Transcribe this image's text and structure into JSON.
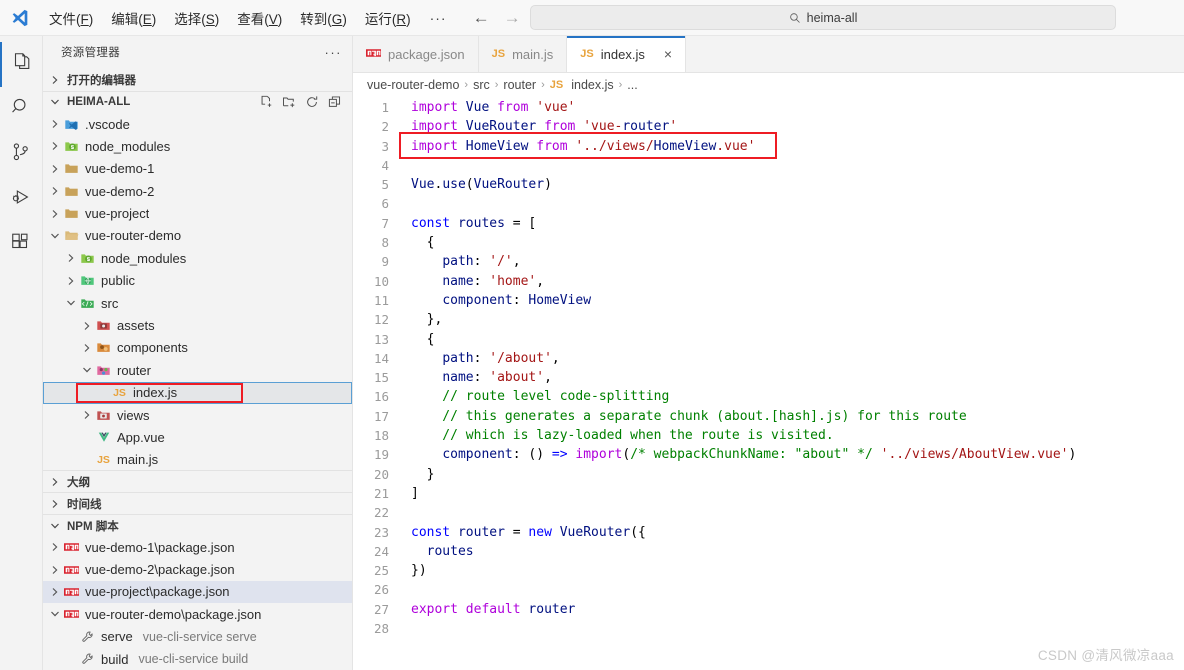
{
  "titlebar": {
    "logo": "vscode-logo",
    "menus": [
      {
        "text": "文件",
        "accel": "F"
      },
      {
        "text": "编辑",
        "accel": "E"
      },
      {
        "text": "选择",
        "accel": "S"
      },
      {
        "text": "查看",
        "accel": "V"
      },
      {
        "text": "转到",
        "accel": "G"
      },
      {
        "text": "运行",
        "accel": "R"
      }
    ],
    "more_label": "···",
    "back_label": "←",
    "forward_label": "→",
    "search": {
      "value": "heima-all",
      "placeholder": "heima-all",
      "icon": "search-icon"
    }
  },
  "activitybar": {
    "items": [
      {
        "name": "explorer",
        "icon": "files-icon",
        "active": true
      },
      {
        "name": "search",
        "icon": "search-icon",
        "active": false
      },
      {
        "name": "source-control",
        "icon": "source-control-icon",
        "active": false
      },
      {
        "name": "run-debug",
        "icon": "run-debug-icon",
        "active": false
      },
      {
        "name": "extensions",
        "icon": "extensions-icon",
        "active": false
      }
    ]
  },
  "sidebar": {
    "title": "资源管理器",
    "more_label": "···",
    "open_editors": {
      "label": "打开的编辑器",
      "expanded": false
    },
    "workspace": {
      "label": "HEIMA-ALL",
      "expanded": true,
      "actions": [
        "new-file-icon",
        "new-folder-icon",
        "refresh-icon",
        "collapse-all-icon"
      ]
    },
    "tree": [
      {
        "label": ".vscode",
        "depth": 1,
        "type": "folder",
        "icon": "vscode-folder-icon",
        "twisty": "collapsed"
      },
      {
        "label": "node_modules",
        "depth": 1,
        "type": "folder",
        "icon": "node-folder-icon",
        "twisty": "collapsed"
      },
      {
        "label": "vue-demo-1",
        "depth": 1,
        "type": "folder",
        "icon": "folder-icon",
        "twisty": "collapsed"
      },
      {
        "label": "vue-demo-2",
        "depth": 1,
        "type": "folder",
        "icon": "folder-icon",
        "twisty": "collapsed"
      },
      {
        "label": "vue-project",
        "depth": 1,
        "type": "folder",
        "icon": "folder-icon",
        "twisty": "collapsed"
      },
      {
        "label": "vue-router-demo",
        "depth": 1,
        "type": "folder",
        "icon": "folder-open-icon",
        "twisty": "expanded"
      },
      {
        "label": "node_modules",
        "depth": 2,
        "type": "folder",
        "icon": "node-folder-icon",
        "twisty": "collapsed"
      },
      {
        "label": "public",
        "depth": 2,
        "type": "folder",
        "icon": "public-folder-icon",
        "twisty": "collapsed"
      },
      {
        "label": "src",
        "depth": 2,
        "type": "folder",
        "icon": "src-folder-icon",
        "twisty": "expanded"
      },
      {
        "label": "assets",
        "depth": 3,
        "type": "folder",
        "icon": "assets-folder-icon",
        "twisty": "collapsed"
      },
      {
        "label": "components",
        "depth": 3,
        "type": "folder",
        "icon": "components-folder-icon",
        "twisty": "collapsed"
      },
      {
        "label": "router",
        "depth": 3,
        "type": "folder",
        "icon": "router-folder-icon",
        "twisty": "expanded"
      },
      {
        "label": "index.js",
        "depth": 4,
        "type": "file",
        "icon": "js-icon",
        "twisty": "none",
        "selected": true,
        "highlighted": true
      },
      {
        "label": "views",
        "depth": 3,
        "type": "folder",
        "icon": "views-folder-icon",
        "twisty": "collapsed"
      },
      {
        "label": "App.vue",
        "depth": 3,
        "type": "file",
        "icon": "vue-icon",
        "twisty": "none"
      },
      {
        "label": "main.js",
        "depth": 3,
        "type": "file",
        "icon": "js-icon",
        "twisty": "none"
      }
    ],
    "outline": {
      "label": "大纲",
      "expanded": false
    },
    "timeline": {
      "label": "时间线",
      "expanded": false
    },
    "npm_scripts": {
      "label": "NPM 脚本",
      "expanded": true,
      "items": [
        {
          "label": "vue-demo-1\\package.json",
          "depth": 1,
          "icon": "npm-icon",
          "twisty": "collapsed"
        },
        {
          "label": "vue-demo-2\\package.json",
          "depth": 1,
          "icon": "npm-icon",
          "twisty": "collapsed"
        },
        {
          "label": "vue-project\\package.json",
          "depth": 1,
          "icon": "npm-icon",
          "twisty": "collapsed",
          "highlighted": true
        },
        {
          "label": "vue-router-demo\\package.json",
          "depth": 1,
          "icon": "npm-icon",
          "twisty": "expanded"
        },
        {
          "label": "serve",
          "detail": "vue-cli-service serve",
          "depth": 2,
          "icon": "wrench-icon",
          "twisty": "none"
        },
        {
          "label": "build",
          "detail": "vue-cli-service build",
          "depth": 2,
          "icon": "wrench-icon",
          "twisty": "none"
        }
      ]
    }
  },
  "editor": {
    "tabs": [
      {
        "label": "package.json",
        "icon": "npm-icon",
        "active": false,
        "closable": false
      },
      {
        "label": "main.js",
        "icon": "js-icon",
        "active": false,
        "closable": false
      },
      {
        "label": "index.js",
        "icon": "js-icon",
        "active": true,
        "closable": true,
        "close_label": "×"
      }
    ],
    "breadcrumb": [
      "vue-router-demo",
      "src",
      "router",
      "index.js",
      "..."
    ],
    "breadcrumb_file_icon": "js-icon",
    "line_numbers": [
      1,
      2,
      3,
      4,
      5,
      6,
      7,
      8,
      9,
      10,
      11,
      12,
      13,
      14,
      15,
      16,
      17,
      18,
      19,
      20,
      21,
      22,
      23,
      24,
      25,
      26,
      27,
      28
    ],
    "lines": [
      "import Vue from 'vue'",
      "import VueRouter from 'vue-router'",
      "import HomeView from '../views/HomeView.vue'",
      "",
      "Vue.use(VueRouter)",
      "",
      "const routes = [",
      "  {",
      "    path: '/',",
      "    name: 'home',",
      "    component: HomeView",
      "  },",
      "  {",
      "    path: '/about',",
      "    name: 'about',",
      "    // route level code-splitting",
      "    // this generates a separate chunk (about.[hash].js) for this route",
      "    // which is lazy-loaded when the route is visited.",
      "    component: () => import(/* webpackChunkName: \"about\" */ '../views/AboutView.vue')",
      "  }",
      "]",
      "",
      "const router = new VueRouter({",
      "  routes",
      "})",
      "",
      "export default router",
      ""
    ],
    "highlight_line": 3,
    "highlight_color": "#ee1c24"
  },
  "watermark": "CSDN @清风微凉aaa",
  "colors": {
    "accent": "#2573c4",
    "red_box": "#ee1c24",
    "selection": "#e4e6e8",
    "sidebar_bg": "#f3f3f3",
    "editor_bg": "#ffffff"
  }
}
